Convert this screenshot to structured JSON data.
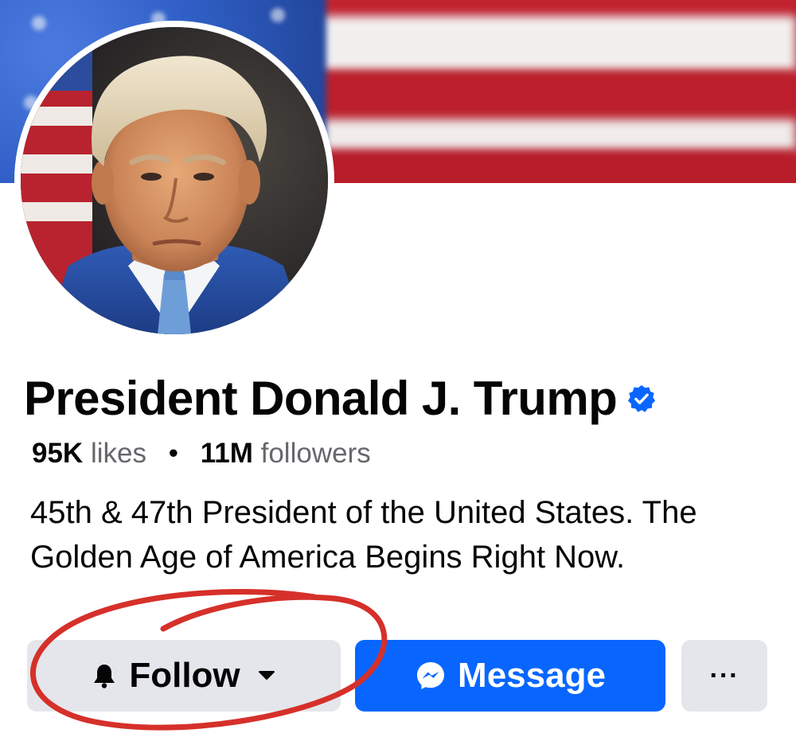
{
  "profile": {
    "name": "President Donald J. Trump",
    "verified": true,
    "likes_count": "95K",
    "likes_label": "likes",
    "separator": "•",
    "followers_count": "11M",
    "followers_label": "followers",
    "bio": "45th & 47th President of the United States. The Golden Age of America Begins Right Now."
  },
  "actions": {
    "follow_label": "Follow",
    "message_label": "Message",
    "more_label": "···"
  },
  "colors": {
    "verified_badge": "#0866ff",
    "message_button": "#0866ff",
    "secondary_button": "#e4e6eb",
    "annotation_circle": "#d6302a"
  },
  "icons": {
    "verified": "verified-badge-icon",
    "follow": "bell-icon",
    "dropdown": "caret-down-icon",
    "message": "messenger-icon",
    "more": "ellipsis-icon"
  }
}
